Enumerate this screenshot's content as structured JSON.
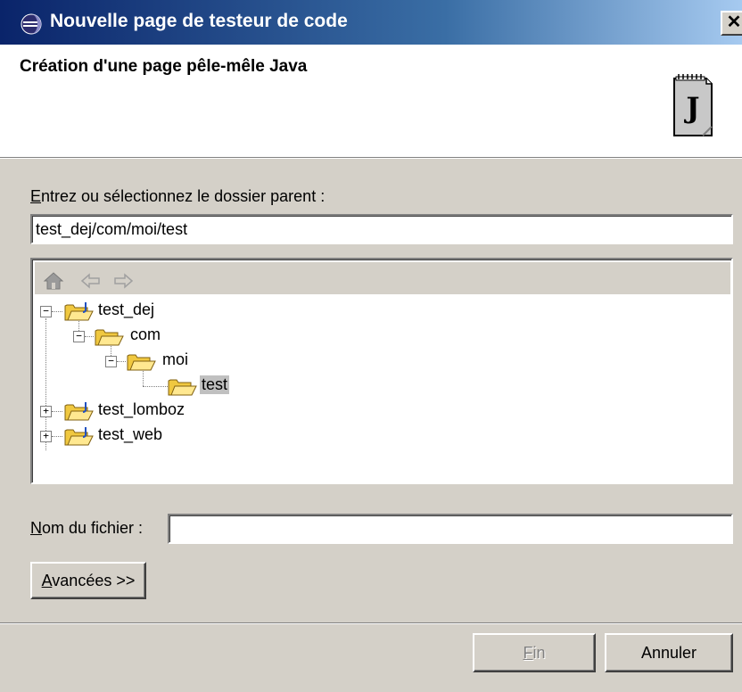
{
  "window": {
    "title": "Nouvelle page de testeur de code",
    "close_glyph": "✕"
  },
  "header": {
    "title": "Création d'une page pêle-mêle Java",
    "icon": "java-file-icon"
  },
  "parent_folder": {
    "label_mnemonic": "E",
    "label_rest": "ntrez ou sélectionnez le dossier parent :",
    "value": "test_dej/com/moi/test"
  },
  "tree": {
    "toolbar_icons": [
      "home-icon",
      "back-arrow-icon",
      "forward-arrow-icon"
    ],
    "items": [
      {
        "label": "test_dej",
        "type": "project",
        "expanded": true,
        "depth": 0
      },
      {
        "label": "com",
        "type": "folder",
        "expanded": true,
        "depth": 1
      },
      {
        "label": "moi",
        "type": "folder",
        "expanded": true,
        "depth": 2
      },
      {
        "label": "test",
        "type": "folder",
        "selected": true,
        "depth": 3
      },
      {
        "label": "test_lomboz",
        "type": "project",
        "expanded": false,
        "depth": 0
      },
      {
        "label": "test_web",
        "type": "project",
        "expanded": false,
        "depth": 0
      }
    ]
  },
  "file_name": {
    "label_mnemonic": "N",
    "label_rest": "om du fichier :",
    "value": ""
  },
  "buttons": {
    "advanced_mnemonic": "A",
    "advanced_rest": "vancées >>",
    "finish_mnemonic": "F",
    "finish_rest": "in",
    "cancel": "Annuler"
  },
  "colors": {
    "title_gradient_start": "#0a246a",
    "title_gradient_end": "#a6caf0",
    "dialog_bg": "#d4d0c8",
    "selection": "#c0c0c0"
  }
}
